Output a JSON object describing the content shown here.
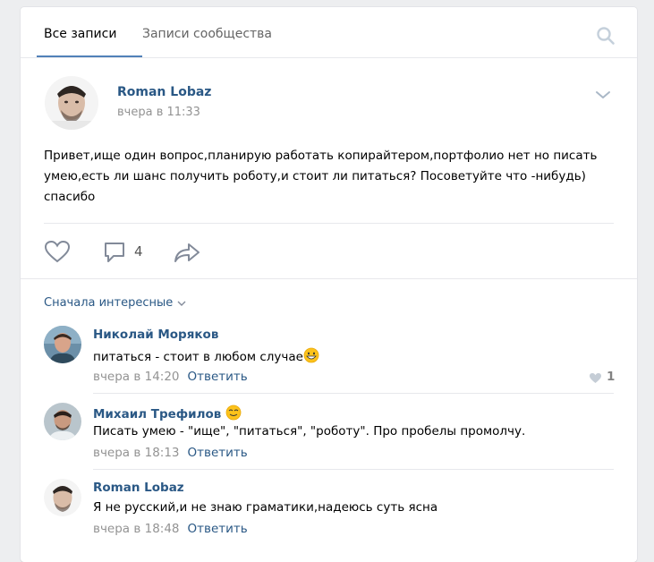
{
  "tabs": {
    "all": "Все записи",
    "community": "Записи сообщества"
  },
  "post": {
    "author": "Roman Lobaz",
    "date": "вчера в 11:33",
    "text": "Привет,ище один вопрос,планирую работать копирайтером,портфолио нет но писать умею,есть ли шанс получить роботу,и стоит ли питаться? Посоветуйте что -нибудь) спасибо",
    "comments_count": "4"
  },
  "sort_label": "Сначала интересные",
  "comments": [
    {
      "author": "Николай Моряков",
      "text": "питаться - стоит в любом случае",
      "date": "вчера в 14:20",
      "reply": "Ответить",
      "likes": "1"
    },
    {
      "author": "Михаил Трефилов",
      "text": "Писать умею - \"ище\", \"питаться\", \"роботу\". Про пробелы промолчу.",
      "date": "вчера в 18:13",
      "reply": "Ответить"
    },
    {
      "author": "Roman Lobaz",
      "text": "Я не русский,и не знаю граматики,надеюсь суть ясна",
      "date": "вчера в 18:48",
      "reply": "Ответить"
    }
  ],
  "colors": {
    "link": "#2a5885",
    "muted": "#939393",
    "accent": "#5181b8"
  }
}
